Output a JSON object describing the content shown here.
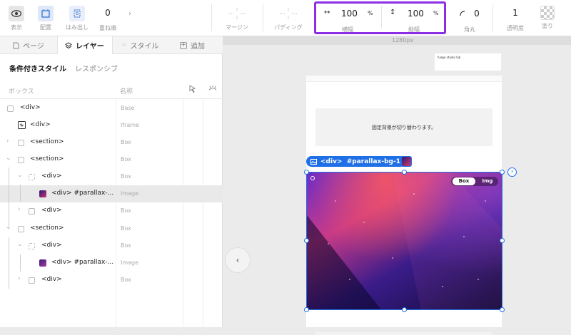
{
  "toolbar": {
    "view_label": "表示",
    "arrange_label": "配置",
    "overflow_label": "はみ出し",
    "zindex_label": "重ね順",
    "zindex_value": "0",
    "margin_label": "マージン",
    "padding_label": "パディング",
    "width_label": "横幅",
    "width_value": "100",
    "width_unit": "%",
    "height_label": "縦幅",
    "height_value": "100",
    "height_unit": "%",
    "radius_label": "角丸",
    "radius_value": "0",
    "opacity_label": "透明度",
    "opacity_value": "1",
    "fill_label": "塗り"
  },
  "sidebar": {
    "tabs": [
      {
        "label": "ページ"
      },
      {
        "label": "レイヤー"
      },
      {
        "label": "スタイル"
      },
      {
        "label": "追加"
      }
    ],
    "subtabs": [
      "条件付きスタイル",
      "レスポンシブ"
    ],
    "columns": {
      "box": "ボックス",
      "name": "名称"
    },
    "rows": [
      {
        "label": "<div>",
        "type": "Base"
      },
      {
        "label": "<div>",
        "type": "Iframe"
      },
      {
        "label": "<section>",
        "type": "Box"
      },
      {
        "label": "<section>",
        "type": "Box"
      },
      {
        "label": "<div>",
        "type": "Box"
      },
      {
        "label": "<div> #parallax-...",
        "type": "Image"
      },
      {
        "label": "<div>",
        "type": "Box"
      },
      {
        "label": "<section>",
        "type": "Box"
      },
      {
        "label": "<div>",
        "type": "Box"
      },
      {
        "label": "<div> #parallax-...",
        "type": "Image"
      },
      {
        "label": "<div>",
        "type": "Box"
      }
    ]
  },
  "canvas": {
    "breakpoint_label": "1280px",
    "fixed_bg_text": "固定背景が切り替わります。",
    "selected_tag": "<div>  #parallax-bg-1",
    "toggle_box": "Box",
    "toggle_img": "Img",
    "mini_preview_title": "fuego studio lab"
  },
  "colors": {
    "accent": "#1f6fe6",
    "highlight": "#8b2ee6"
  }
}
